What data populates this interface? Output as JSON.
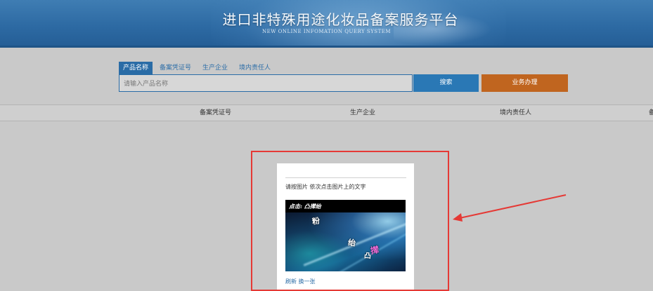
{
  "header": {
    "title": "进口非特殊用途化妆品备案服务平台",
    "subtitle": "NEW ONLINE INFOMATION QUERY SYSTEM"
  },
  "search": {
    "tabs": [
      {
        "label": "产品名称",
        "active": true
      },
      {
        "label": "备案凭证号",
        "active": false
      },
      {
        "label": "生产企业",
        "active": false
      },
      {
        "label": "境内责任人",
        "active": false
      }
    ],
    "placeholder": "请输入产品名称",
    "search_label": "搜索",
    "business_label": "业务办理"
  },
  "table": {
    "columns": [
      "备案凭证号",
      "生产企业",
      "境内责任人",
      "备"
    ]
  },
  "captcha": {
    "instruction": "请按图片 依次点击图片上的文字",
    "prompt": "点击: 凸撵绐",
    "chars": [
      "粉",
      "绐",
      "撵",
      "凸"
    ],
    "refresh_label": "刷新 换一张"
  },
  "colors": {
    "banner": "#2d6aa3",
    "accent_blue": "#2a78b5",
    "accent_orange": "#c0651f",
    "highlight_red": "#e53935"
  }
}
